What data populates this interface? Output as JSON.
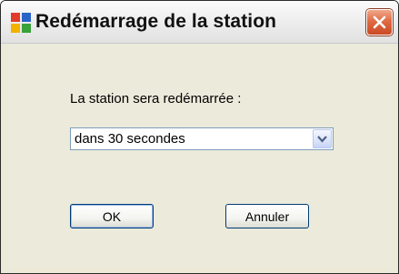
{
  "window": {
    "title": "Redémarrage de la station",
    "icon": "avg-logo-icon"
  },
  "titlebar": {
    "close_icon": "close-icon",
    "close_color": "#d9542b"
  },
  "form": {
    "prompt": "La station sera redémarrée :",
    "select_value": "dans 30 secondes",
    "select_arrow_icon": "chevron-down-icon"
  },
  "buttons": {
    "ok_label": "OK",
    "cancel_label": "Annuler"
  }
}
